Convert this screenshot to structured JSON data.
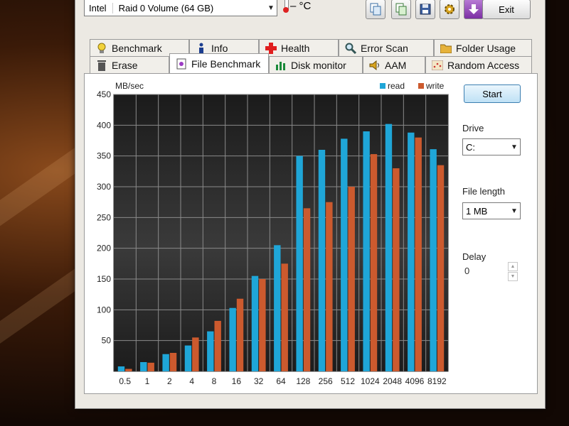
{
  "toolbar": {
    "drive_vendor": "Intel",
    "drive_name": "Raid 0 Volume (64 GB)",
    "temperature": "– °C",
    "exit_label": "Exit"
  },
  "tabs": [
    {
      "label": "Benchmark"
    },
    {
      "label": "Info"
    },
    {
      "label": "Health"
    },
    {
      "label": "Error Scan"
    },
    {
      "label": "Folder Usage"
    },
    {
      "label": "Erase"
    },
    {
      "label": "File Benchmark"
    },
    {
      "label": "Disk monitor"
    },
    {
      "label": "AAM"
    },
    {
      "label": "Random Access"
    }
  ],
  "controls": {
    "start_label": "Start",
    "drive_label": "Drive",
    "drive_value": "C:",
    "file_length_label": "File length",
    "file_length_value": "1 MB",
    "delay_label": "Delay",
    "delay_value": "0"
  },
  "colors": {
    "read": "#1fa6d8",
    "write": "#cc5a2e"
  },
  "chart_data": {
    "type": "bar",
    "ylabel": "MB/sec",
    "ylim": [
      0,
      450
    ],
    "yticks": [
      50,
      100,
      150,
      200,
      250,
      300,
      350,
      400,
      450
    ],
    "grid": true,
    "legend": "top-right",
    "categories": [
      "0.5",
      "1",
      "2",
      "4",
      "8",
      "16",
      "32",
      "64",
      "128",
      "256",
      "512",
      "1024",
      "2048",
      "4096",
      "8192"
    ],
    "series": [
      {
        "name": "read",
        "values": [
          8,
          15,
          28,
          42,
          65,
          103,
          155,
          205,
          350,
          360,
          378,
          390,
          402,
          388,
          361
        ]
      },
      {
        "name": "write",
        "values": [
          4,
          14,
          30,
          55,
          82,
          118,
          150,
          175,
          265,
          275,
          300,
          353,
          330,
          380,
          335
        ]
      }
    ]
  }
}
